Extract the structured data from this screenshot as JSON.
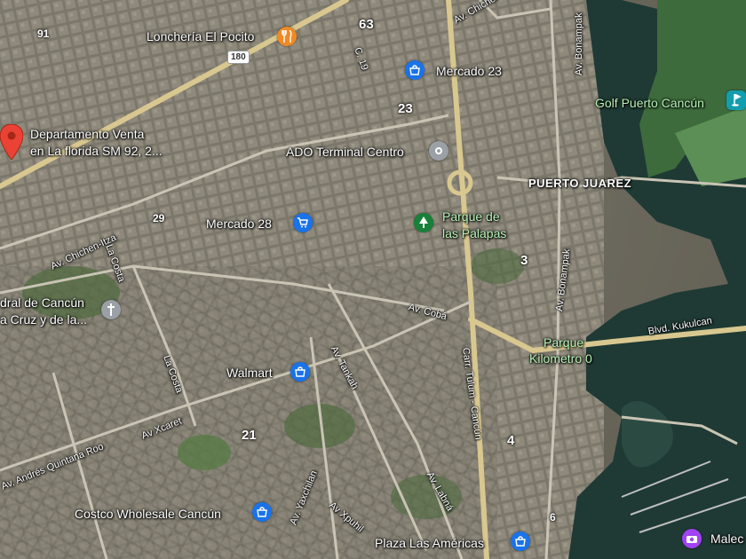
{
  "map": {
    "places": {
      "loncheria": "Lonchería El Pocito",
      "mercado23": "Mercado 23",
      "depto_line1": "Departamento Venta",
      "depto_line2": "en La florida SM 92, 2...",
      "ado": "ADO Terminal Centro",
      "puerto_juarez": "PUERTO JUAREZ",
      "parque_palapas_1": "Parque de",
      "parque_palapas_2": "las Palapas",
      "mercado28": "Mercado 28",
      "catedral_1": "dral de Cancún",
      "catedral_2": "a Cruz y de la...",
      "walmart": "Walmart",
      "parque_km0_1": "Parque",
      "parque_km0_2": "Kilometro 0",
      "golf": "Golf Puerto Cancún",
      "costco": "Costco Wholesale Cancún",
      "plaza_americas": "Plaza Las Américas",
      "malecon": "Malec"
    },
    "streets": {
      "chichen_itza_top": "Av. Chichen-Itza",
      "chichen_itza_left": "Av. Chichen-Itza",
      "bonampak_top": "Av. Bonampak",
      "bonampak_mid": "Av. Bonampak",
      "la_costa_1": "La Costa",
      "la_costa_2": "La Costa",
      "coba": "Av. Cobá",
      "kukulcan": "Blvd. Kukulcan",
      "tulum": "Carr. Tulum - Cancún",
      "tankah": "Av. Tankah",
      "xcaret": "Av Xcaret",
      "andres_qroo": "Av. Andrés Quintana Roo",
      "yaxchilan": "Av. Yaxchilan",
      "xpuhil": "Av Xpuhil",
      "labna": "Av. Labná",
      "c19": "C. 19"
    },
    "route_shield": "180",
    "district_numbers": {
      "n91": "91",
      "n63": "63",
      "n23": "23",
      "n29": "29",
      "n3": "3",
      "n21": "21",
      "n4": "4",
      "n6": "6"
    },
    "icons": {
      "restaurant": "fork-knife-icon",
      "shopping": "shopping-bag-icon",
      "transit": "bus-station-icon",
      "park": "tree-icon",
      "church": "cross-icon",
      "golf": "golf-icon",
      "museum": "camera-icon",
      "pin": "red-map-pin-icon"
    },
    "colors": {
      "water": "#1f3a34",
      "road_major": "#d8c78f",
      "poi_blue": "#1a73e8",
      "poi_orange": "#f08a24",
      "poi_green": "#188038",
      "pin_red": "#ea4335"
    }
  }
}
